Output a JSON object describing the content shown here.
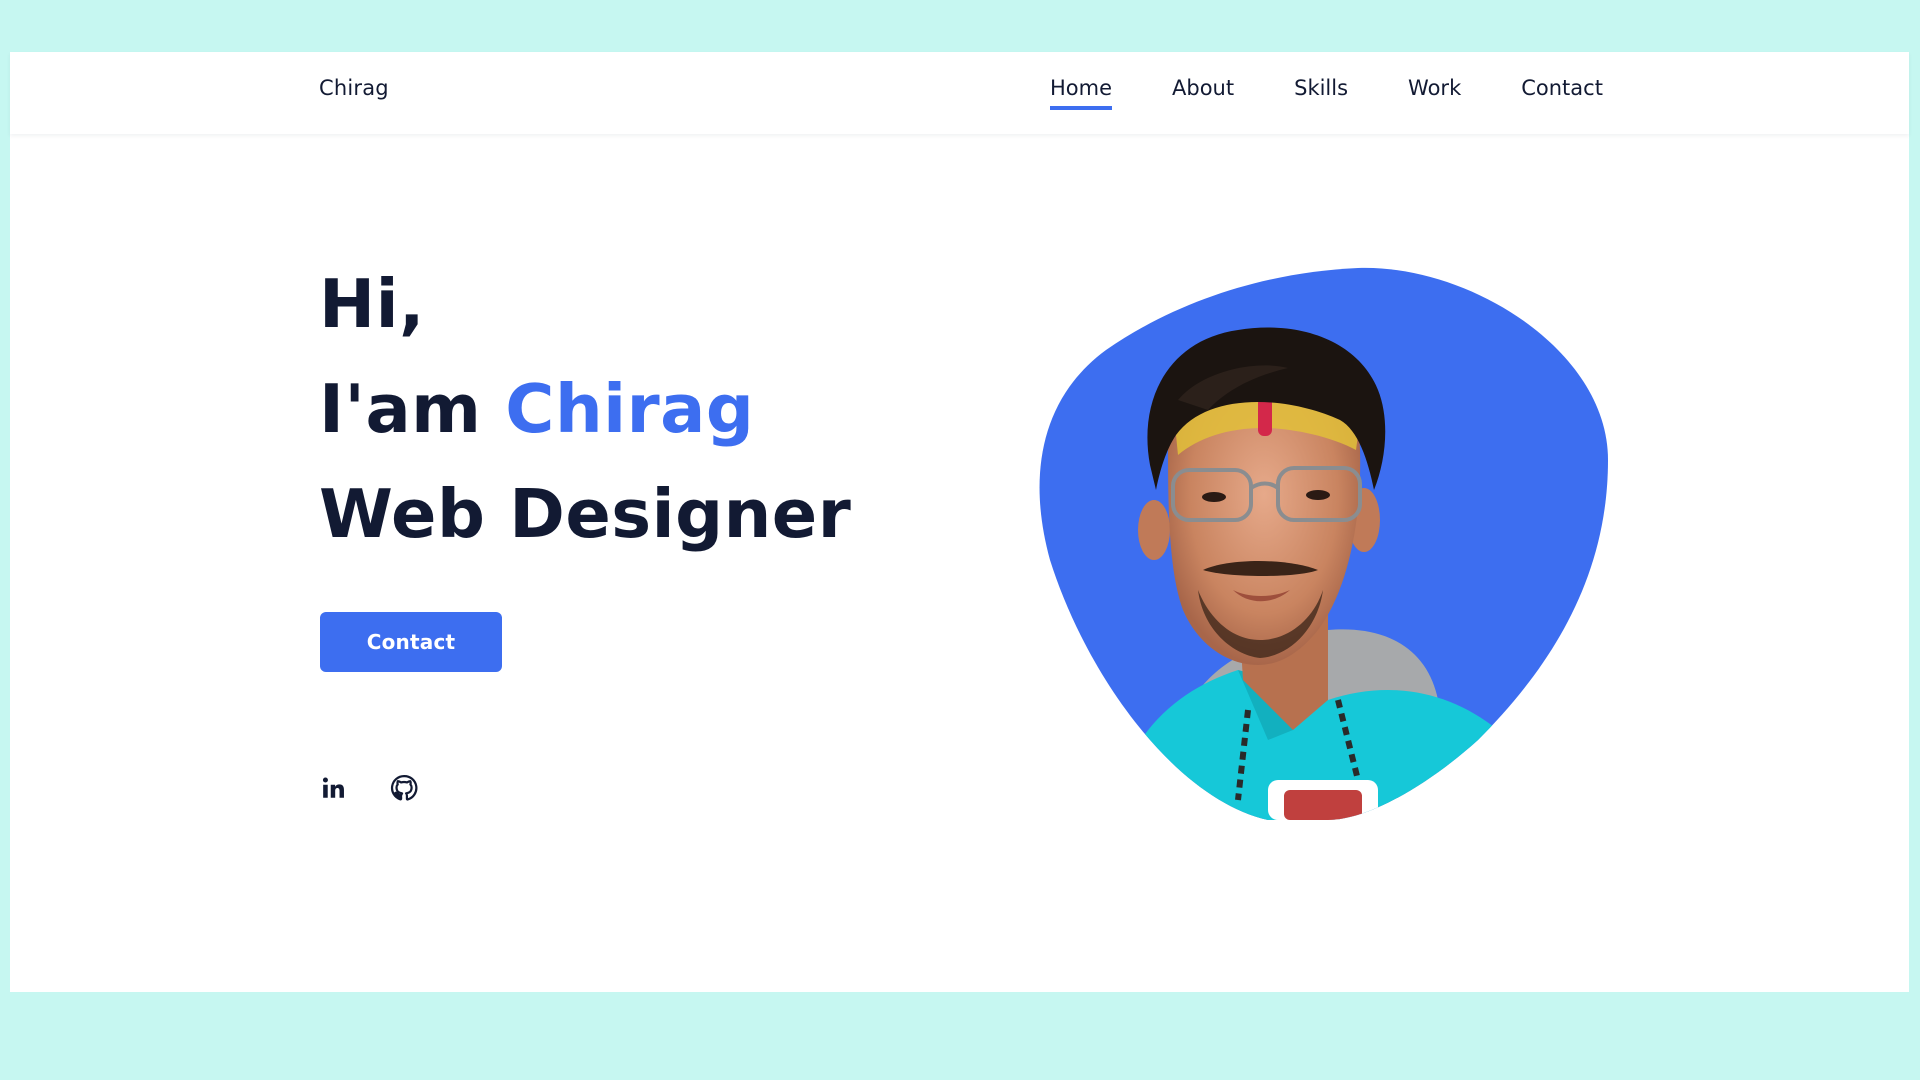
{
  "navbar": {
    "logo": "Chirag",
    "links": [
      {
        "label": "Home",
        "active": true
      },
      {
        "label": "About",
        "active": false
      },
      {
        "label": "Skills",
        "active": false
      },
      {
        "label": "Work",
        "active": false
      },
      {
        "label": "Contact",
        "active": false
      }
    ]
  },
  "hero": {
    "greeting": "Hi,",
    "intro_prefix": "I'am ",
    "name": "Chirag",
    "role": "Web Designer",
    "cta_label": "Contact"
  },
  "socials": [
    {
      "icon": "linkedin-icon"
    },
    {
      "icon": "github-icon"
    }
  ],
  "colors": {
    "accent": "#3d6ef0",
    "text": "#121a33",
    "page_bg": "#c6f7f1",
    "card_bg": "#ffffff"
  }
}
